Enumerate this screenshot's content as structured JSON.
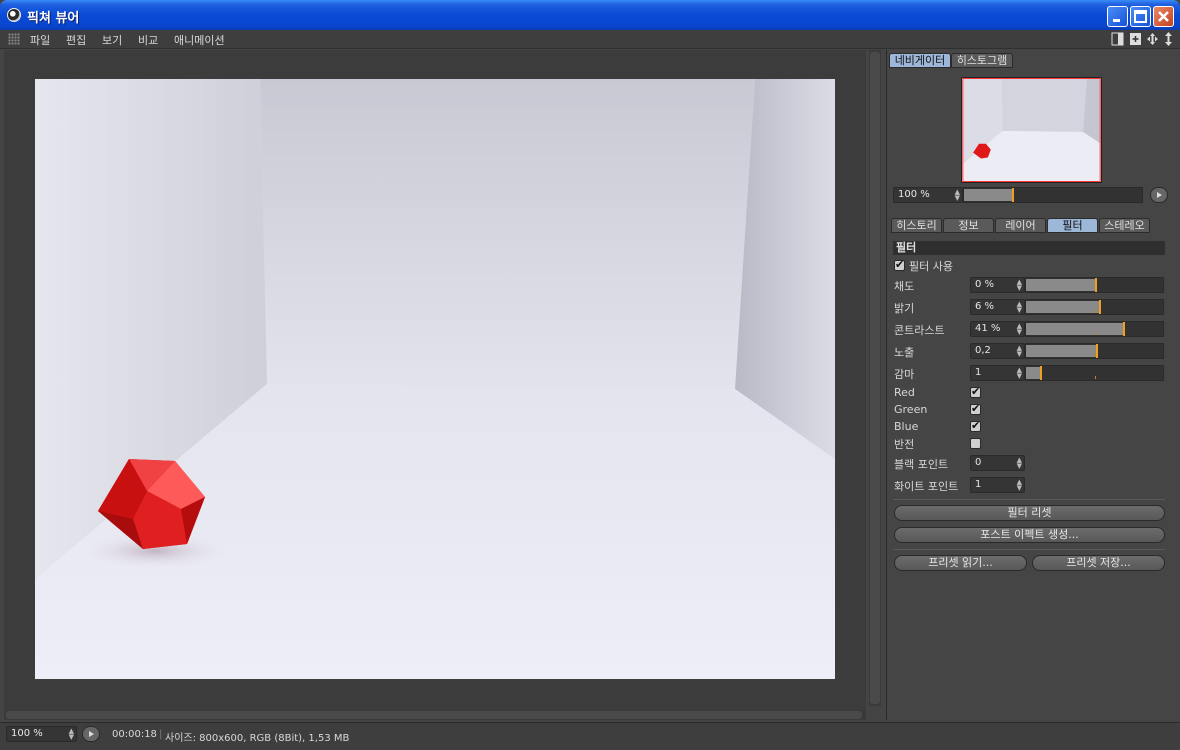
{
  "window": {
    "title": "픽쳐 뷰어"
  },
  "menu": {
    "items": [
      "파일",
      "편집",
      "보기",
      "비교",
      "애니메이션"
    ]
  },
  "navigator": {
    "tabs": [
      "네비게이터",
      "히스토그램"
    ],
    "active_tab": 0,
    "zoom": "100 %",
    "zoom_level": 0.27
  },
  "panel_tabs": {
    "items": [
      "히스토리",
      "정보",
      "레이어",
      "필터",
      "스테레오"
    ],
    "active": 3
  },
  "filter": {
    "section_title": "필터",
    "enable_label": "필터 사용",
    "enabled": true,
    "sliders": [
      {
        "label": "채도",
        "value": "0 %",
        "level": 0.5
      },
      {
        "label": "밝기",
        "value": "6 %",
        "level": 0.53
      },
      {
        "label": "콘트라스트",
        "value": "41 %",
        "level": 0.71
      },
      {
        "label": "노출",
        "value": "0,2",
        "level": 0.51
      },
      {
        "label": "감마",
        "value": "1",
        "level": 0.1
      }
    ],
    "channels": [
      {
        "label": "Red",
        "checked": true
      },
      {
        "label": "Green",
        "checked": true
      },
      {
        "label": "Blue",
        "checked": true
      },
      {
        "label": "반전",
        "checked": false
      }
    ],
    "black_point": {
      "label": "블랙 포인트",
      "value": "0"
    },
    "white_point": {
      "label": "화이트 포인트",
      "value": "1"
    },
    "reset_button": "필터 리셋",
    "posteffect_button": "포스트 이펙트 생성...",
    "preset_load_button": "프리셋 읽기...",
    "preset_save_button": "프리셋 저장..."
  },
  "status": {
    "zoom": "100 %",
    "time": "00:00:18",
    "info": "사이즈: 800x600, RGB (8Bit), 1,53 MB"
  },
  "colors": {
    "accent_tab": "#9cb7d8",
    "slider_marker": "#f0a020",
    "object_red": "#e01818"
  }
}
